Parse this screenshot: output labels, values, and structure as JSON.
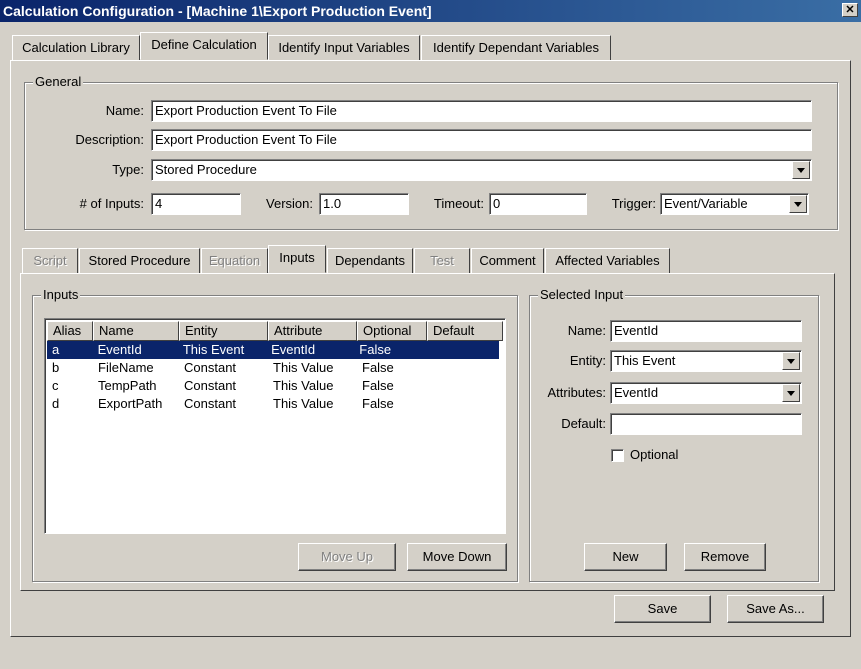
{
  "window": {
    "title": "Calculation Configuration - [Machine 1\\Export Production Event]",
    "close_symbol": "✕"
  },
  "top_tabs": [
    {
      "label": "Calculation Library"
    },
    {
      "label": "Define Calculation"
    },
    {
      "label": "Identify Input Variables"
    },
    {
      "label": "Identify Dependant Variables"
    }
  ],
  "general": {
    "group_label": "General",
    "name_label": "Name:",
    "name_value": "Export Production Event To File",
    "description_label": "Description:",
    "description_value": "Export Production Event To File",
    "type_label": "Type:",
    "type_value": "Stored Procedure",
    "inputs_count_label": "# of Inputs:",
    "inputs_count_value": "4",
    "version_label": "Version:",
    "version_value": "1.0",
    "timeout_label": "Timeout:",
    "timeout_value": "0",
    "trigger_label": "Trigger:",
    "trigger_value": "Event/Variable"
  },
  "sub_tabs": [
    {
      "label": "Script",
      "disabled": true
    },
    {
      "label": "Stored Procedure",
      "disabled": false
    },
    {
      "label": "Equation",
      "disabled": true
    },
    {
      "label": "Inputs",
      "disabled": false
    },
    {
      "label": "Dependants",
      "disabled": false
    },
    {
      "label": "Test",
      "disabled": true
    },
    {
      "label": "Comment",
      "disabled": false
    },
    {
      "label": "Affected Variables",
      "disabled": false
    }
  ],
  "inputs_group": {
    "label": "Inputs",
    "columns": [
      "Alias",
      "Name",
      "Entity",
      "Attribute",
      "Optional",
      "Default"
    ],
    "rows": [
      [
        "a",
        "EventId",
        "This Event",
        "EventId",
        "False",
        ""
      ],
      [
        "b",
        "FileName",
        "Constant",
        "This Value",
        "False",
        ""
      ],
      [
        "c",
        "TempPath",
        "Constant",
        "This Value",
        "False",
        ""
      ],
      [
        "d",
        "ExportPath",
        "Constant",
        "This Value",
        "False",
        ""
      ]
    ],
    "selected_row": 0,
    "move_up_label": "Move Up",
    "move_down_label": "Move Down"
  },
  "selected_input": {
    "label": "Selected Input",
    "name_label": "Name:",
    "name_value": "EventId",
    "entity_label": "Entity:",
    "entity_value": "This Event",
    "attributes_label": "Attributes:",
    "attributes_value": "EventId",
    "default_label": "Default:",
    "default_value": "",
    "optional_label": "Optional",
    "optional_checked": false,
    "new_label": "New",
    "remove_label": "Remove"
  },
  "footer": {
    "save_label": "Save",
    "save_as_label": "Save As..."
  },
  "colors": {
    "face": "#d4d0c8",
    "title_start": "#0a246a",
    "title_end": "#3a6ea5",
    "selection": "#0a246a"
  }
}
